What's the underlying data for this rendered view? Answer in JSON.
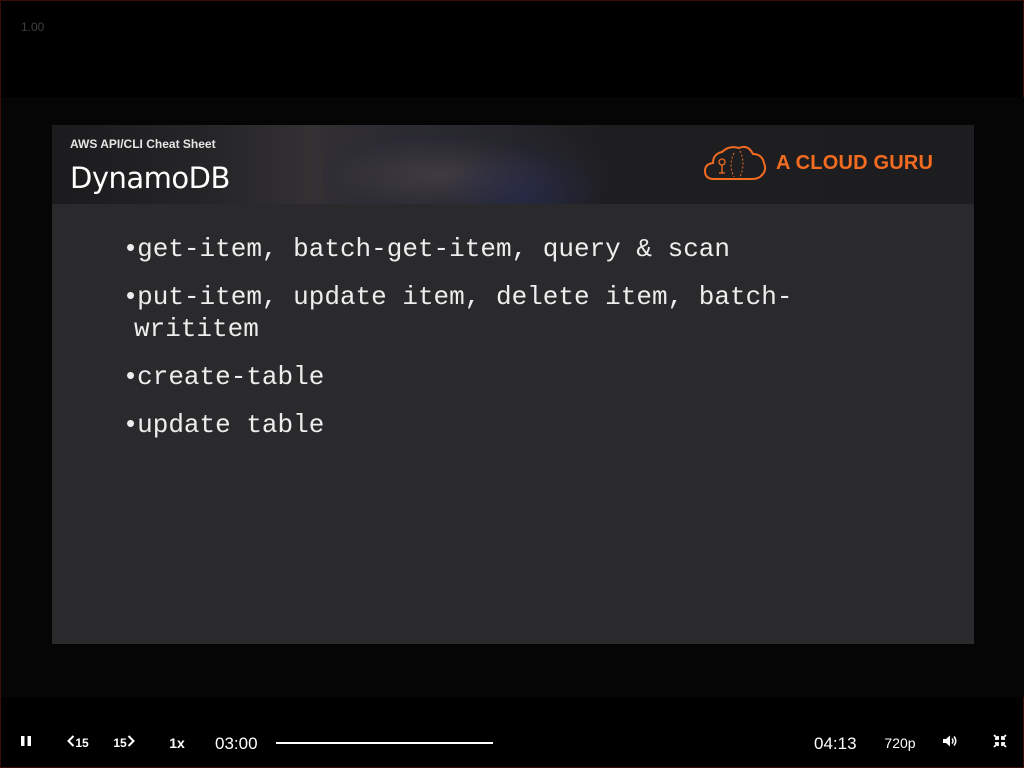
{
  "player": {
    "speed_indicator": "1.00",
    "current_time": "03:00",
    "total_time": "04:13",
    "playback_rate": "1x",
    "quality": "720p",
    "skip_back_label": "15",
    "skip_forward_label": "15",
    "accent_color": "#f26b21"
  },
  "slide": {
    "subtitle": "AWS API/CLI Cheat Sheet",
    "title": "DynamoDB",
    "brand": "A CLOUD GURU",
    "bullets": [
      "get-item, batch-get-item, query & scan",
      "put-item, update item, delete item, batch-writitem",
      "create-table",
      "update table"
    ]
  },
  "icons": {
    "pause": "pause-icon",
    "skip_back": "rewind-15-icon",
    "skip_forward": "forward-15-icon",
    "volume": "volume-icon",
    "fullscreen": "exit-fullscreen-icon",
    "brand_logo": "cloud-logo-icon"
  }
}
